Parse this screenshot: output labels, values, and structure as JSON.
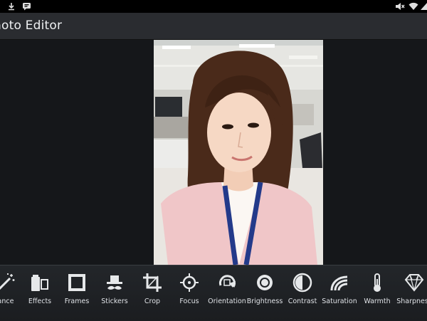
{
  "status_bar": {
    "left_icons": [
      "download-icon",
      "message-icon"
    ],
    "right_icons": [
      "mute-icon",
      "wifi-icon",
      "signal-icon"
    ]
  },
  "app": {
    "title": "hoto Editor"
  },
  "photo": {
    "subject": "portrait-photo"
  },
  "toolbar": {
    "tools": [
      {
        "label": "ance",
        "icon": "wand-icon"
      },
      {
        "label": "Effects",
        "icon": "effects-icon"
      },
      {
        "label": "Frames",
        "icon": "frame-icon"
      },
      {
        "label": "Stickers",
        "icon": "hat-mustache-icon"
      },
      {
        "label": "Crop",
        "icon": "crop-icon"
      },
      {
        "label": "Focus",
        "icon": "focus-icon"
      },
      {
        "label": "Orientation",
        "icon": "rotate-icon"
      },
      {
        "label": "Brightness",
        "icon": "sun-icon"
      },
      {
        "label": "Contrast",
        "icon": "contrast-icon"
      },
      {
        "label": "Saturation",
        "icon": "saturation-icon"
      },
      {
        "label": "Warmth",
        "icon": "thermometer-icon"
      },
      {
        "label": "Sharpness",
        "icon": "diamond-icon"
      }
    ]
  }
}
